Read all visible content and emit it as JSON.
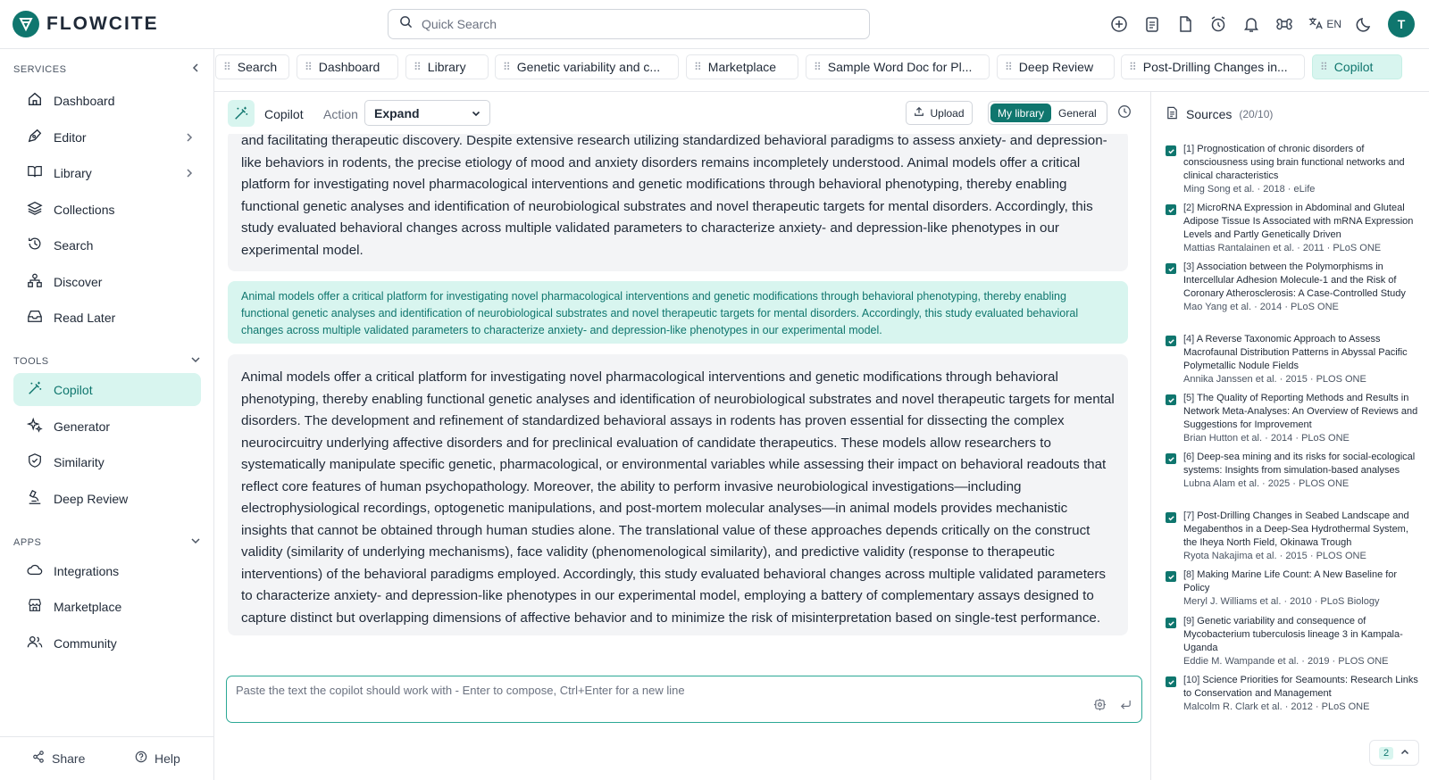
{
  "brand": {
    "name": "FLOWCITE"
  },
  "search": {
    "placeholder": "Quick Search"
  },
  "topbar": {
    "lang": "EN",
    "avatar": "T"
  },
  "sidebar": {
    "services_label": "SERVICES",
    "services": [
      {
        "label": "Dashboard"
      },
      {
        "label": "Editor"
      },
      {
        "label": "Library"
      },
      {
        "label": "Collections"
      },
      {
        "label": "Search"
      },
      {
        "label": "Discover"
      },
      {
        "label": "Read Later"
      }
    ],
    "tools_label": "TOOLS",
    "tools": [
      {
        "label": "Copilot"
      },
      {
        "label": "Generator"
      },
      {
        "label": "Similarity"
      },
      {
        "label": "Deep Review"
      }
    ],
    "apps_label": "APPS",
    "apps": [
      {
        "label": "Integrations"
      },
      {
        "label": "Marketplace"
      },
      {
        "label": "Community"
      }
    ],
    "share": "Share",
    "help": "Help"
  },
  "tabs": [
    {
      "label": "Search"
    },
    {
      "label": "Dashboard"
    },
    {
      "label": "Library"
    },
    {
      "label": "Genetic variability and c..."
    },
    {
      "label": "Marketplace"
    },
    {
      "label": "Sample Word Doc for Pl..."
    },
    {
      "label": "Deep Review"
    },
    {
      "label": "Post-Drilling Changes in..."
    },
    {
      "label": "Copilot"
    }
  ],
  "copilot": {
    "title": "Copilot",
    "action_label": "Action",
    "action_value": "Expand",
    "upload": "Upload",
    "scope_my": "My library",
    "scope_general": "General"
  },
  "content": {
    "card1": "and facilitating therapeutic discovery. Despite extensive research utilizing standardized behavioral paradigms to assess anxiety- and depression-like behaviors in rodents, the precise etiology of mood and anxiety disorders remains incompletely understood. Animal models offer a critical platform for investigating novel pharmacological interventions and genetic modifications through behavioral phenotyping, thereby enabling functional genetic analyses and identification of neurobiological substrates and novel therapeutic targets for mental disorders. Accordingly, this study evaluated behavioral changes across multiple validated parameters to characterize anxiety- and depression-like phenotypes in our experimental model.",
    "selection": "Animal models offer a critical platform for investigating novel pharmacological interventions and genetic modifications through behavioral phenotyping, thereby enabling functional genetic analyses and identification of neurobiological substrates and novel therapeutic targets for mental disorders. Accordingly, this study evaluated behavioral changes across multiple validated parameters to characterize anxiety- and depression-like phenotypes in our experimental model.",
    "card2": "Animal models offer a critical platform for investigating novel pharmacological interventions and genetic modifications through behavioral phenotyping, thereby enabling functional genetic analyses and identification of neurobiological substrates and novel therapeutic targets for mental disorders. The development and refinement of standardized behavioral assays in rodents has proven essential for dissecting the complex neurocircuitry underlying affective disorders and for preclinical evaluation of candidate therapeutics. These models allow researchers to systematically manipulate specific genetic, pharmacological, or environmental variables while assessing their impact on behavioral readouts that reflect core features of human psychopathology. Moreover, the ability to perform invasive neurobiological investigations—including electrophysiological recordings, optogenetic manipulations, and post-mortem molecular analyses—in animal models provides mechanistic insights that cannot be obtained through human studies alone. The translational value of these approaches depends critically on the construct validity (similarity of underlying mechanisms), face validity (phenomenological similarity), and predictive validity (response to therapeutic interventions) of the behavioral paradigms employed. Accordingly, this study evaluated behavioral changes across multiple validated parameters to characterize anxiety- and depression-like phenotypes in our experimental model, employing a battery of complementary assays designed to capture distinct but overlapping dimensions of affective behavior and to minimize the risk of misinterpretation based on single-test performance."
  },
  "composer": {
    "placeholder": "Paste the text the copilot should work with - Enter to compose, Ctrl+Enter for a new line"
  },
  "sources": {
    "title": "Sources",
    "count": "(20/10)",
    "items": [
      {
        "num": "[1]",
        "title": "Prognostication of chronic disorders of consciousness using brain functional networks and clinical characteristics",
        "meta": "Ming Song et al. · 2018 · eLife"
      },
      {
        "num": "[2]",
        "title": "MicroRNA Expression in Abdominal and Gluteal Adipose Tissue Is Associated with mRNA Expression Levels and Partly Genetically Driven",
        "meta": "Mattias Rantalainen et al. · 2011 · PLoS ONE"
      },
      {
        "num": "[3]",
        "title": "Association between the Polymorphisms in Intercellular Adhesion Molecule-1 and the Risk of Coronary Atherosclerosis: A Case-Controlled Study",
        "meta": "Mao Yang et al. · 2014 · PLoS ONE"
      },
      {
        "num": "[4]",
        "title": "A Reverse Taxonomic Approach to Assess Macrofaunal Distribution Patterns in Abyssal Pacific Polymetallic Nodule Fields",
        "meta": "Annika Janssen et al. · 2015 · PLOS ONE"
      },
      {
        "num": "[5]",
        "title": "The Quality of Reporting Methods and Results in Network Meta-Analyses: An Overview of Reviews and Suggestions for Improvement",
        "meta": "Brian Hutton et al. · 2014 · PLoS ONE"
      },
      {
        "num": "[6]",
        "title": "Deep-sea mining and its risks for social-ecological systems: Insights from simulation-based analyses",
        "meta": "Lubna Alam et al. · 2025 · PLOS ONE"
      },
      {
        "num": "[7]",
        "title": "Post-Drilling Changes in Seabed Landscape and Megabenthos in a Deep-Sea Hydrothermal System, the Iheya North Field, Okinawa Trough",
        "meta": "Ryota Nakajima et al. · 2015 · PLOS ONE"
      },
      {
        "num": "[8]",
        "title": "Making Marine Life Count: A New Baseline for Policy",
        "meta": "Meryl J. Williams et al. · 2010 · PLoS Biology"
      },
      {
        "num": "[9]",
        "title": "Genetic variability and consequence of Mycobacterium tuberculosis lineage 3 in Kampala-Uganda",
        "meta": "Eddie M. Wampande et al. · 2019 · PLOS ONE"
      },
      {
        "num": "[10]",
        "title": "Science Priorities for Seamounts: Research Links to Conservation and Management",
        "meta": "Malcolm R. Clark et al. · 2012 · PLoS ONE"
      }
    ]
  },
  "pager": {
    "page": "2"
  },
  "colors": {
    "accent": "#0f766e",
    "accent_light": "#d8f5ef"
  }
}
